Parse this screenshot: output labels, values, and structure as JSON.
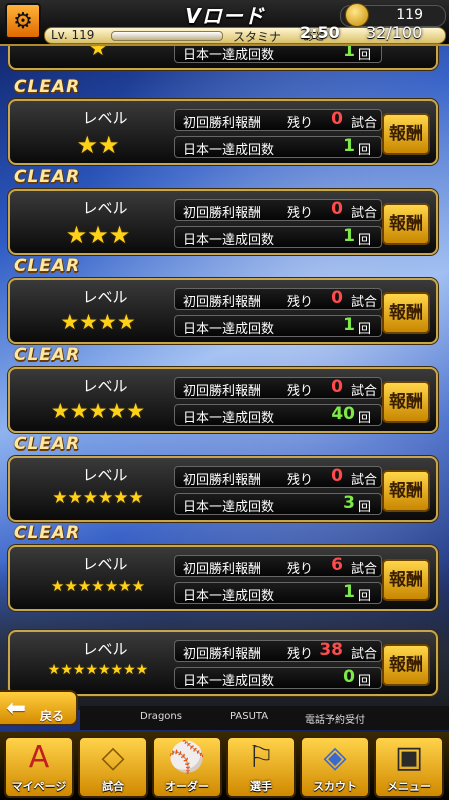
{
  "header": {
    "title": "Vロード",
    "coins": "119",
    "level": "Lv. 119",
    "stamina_label": "スタミナ",
    "ato_label": "あと",
    "timer": "2:50",
    "stamina_value": "32/100"
  },
  "colors": {
    "gold": "#c9a64c",
    "red_count": "#ff4b4b",
    "green_count": "#7dea47",
    "star": "#ffd21a"
  },
  "common": {
    "clear": "CLEAR",
    "level_label": "レベル",
    "first_win_label": "初回勝利報酬",
    "remaining_label": "残り",
    "games_unit": "試合",
    "champion_label": "日本一達成回数",
    "times_unit": "回",
    "reward_button": "報酬"
  },
  "top_partial": {
    "stars": "★",
    "champion_count": "1"
  },
  "levels": [
    {
      "stars": "★★",
      "clear": true,
      "remaining": "0",
      "champion_count": "1"
    },
    {
      "stars": "★★★",
      "clear": true,
      "remaining": "0",
      "champion_count": "1"
    },
    {
      "stars": "★★★★",
      "clear": true,
      "remaining": "0",
      "champion_count": "1"
    },
    {
      "stars": "★★★★★",
      "clear": true,
      "remaining": "0",
      "champion_count": "40"
    },
    {
      "stars": "★★★★★★",
      "clear": true,
      "remaining": "0",
      "champion_count": "3"
    },
    {
      "stars": "★★★★★★★",
      "clear": true,
      "remaining": "6",
      "champion_count": "1"
    },
    {
      "stars": "★★★★★★★★",
      "clear": false,
      "remaining": "38",
      "champion_count": "0"
    }
  ],
  "back_button": "戻る",
  "sponsors": [
    "Dragons",
    "PASUTA",
    "電話予約受付"
  ],
  "nav": [
    {
      "label": "マイページ",
      "icon": "A"
    },
    {
      "label": "試合",
      "icon": "◇"
    },
    {
      "label": "オーダー",
      "icon": "⚾"
    },
    {
      "label": "選手",
      "icon": "⚐"
    },
    {
      "label": "スカウト",
      "icon": "◈"
    },
    {
      "label": "メニュー",
      "icon": "▣"
    }
  ]
}
